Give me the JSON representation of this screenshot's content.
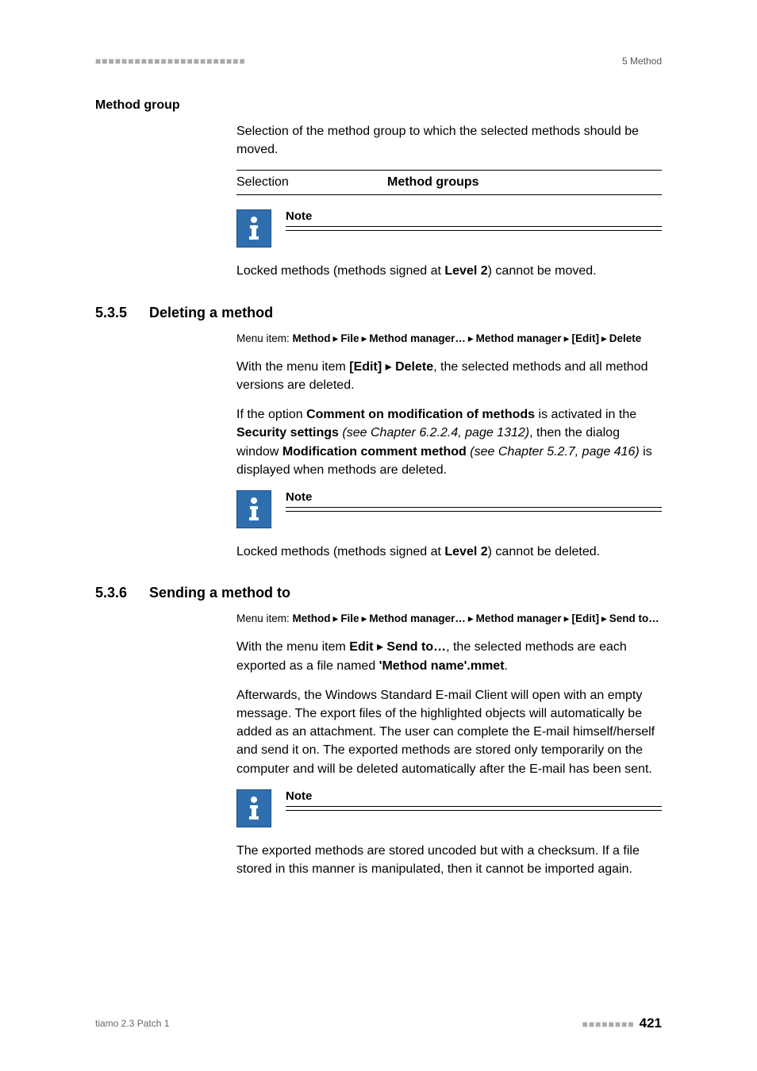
{
  "header": {
    "dashes": "■■■■■■■■■■■■■■■■■■■■■■■",
    "section_label": "5 Method"
  },
  "method_group": {
    "heading": "Method group",
    "body": "Selection of the method group to which the selected methods should be moved.",
    "selection_label": "Selection",
    "selection_value": "Method groups",
    "note_title": "Note",
    "note_body_pre": "Locked methods (methods signed at ",
    "note_body_bold": "Level 2",
    "note_body_post": ") cannot be moved."
  },
  "s535": {
    "num": "5.3.5",
    "title": "Deleting a method",
    "menu_prefix": "Menu item: ",
    "menu_parts": [
      "Method",
      "File",
      "Method manager…",
      "Method manager",
      "[Edit]",
      "Delete"
    ],
    "p1_pre": "With the menu item ",
    "p1_b1": "[Edit]",
    "p1_mid": " ▸ ",
    "p1_b2": "Delete",
    "p1_post": ", the selected methods and all method versions are deleted.",
    "p2_a": "If the option ",
    "p2_b1": "Comment on modification of methods",
    "p2_b": " is activated in the ",
    "p2_b2": "Security settings",
    "p2_i1": " (see Chapter 6.2.2.4, page 1312)",
    "p2_c": ", then the dialog window ",
    "p2_b3": "Modification comment method",
    "p2_i2": " (see Chapter 5.2.7, page 416)",
    "p2_d": " is displayed when methods are deleted.",
    "note_title": "Note",
    "note_body_pre": "Locked methods (methods signed at ",
    "note_body_bold": "Level 2",
    "note_body_post": ") cannot be deleted."
  },
  "s536": {
    "num": "5.3.6",
    "title": "Sending a method to",
    "menu_prefix": "Menu item: ",
    "menu_parts": [
      "Method",
      "File",
      "Method manager…",
      "Method manager",
      "[Edit]",
      "Send to…"
    ],
    "p1_pre": "With the menu item ",
    "p1_b1": "Edit",
    "p1_mid": " ▸ ",
    "p1_b2": "Send to…",
    "p1_post": ", the selected methods are each exported as a file named ",
    "p1_b3": "'Method name'.mmet",
    "p1_end": ".",
    "p2": "Afterwards, the Windows Standard E-mail Client will open with an empty message. The export files of the highlighted objects will automatically be added as an attachment. The user can complete the E-mail himself/herself and send it on. The exported methods are stored only temporarily on the computer and will be deleted automatically after the E-mail has been sent.",
    "note_title": "Note",
    "note_body": "The exported methods are stored uncoded but with a checksum. If a file stored in this manner is manipulated, then it cannot be imported again."
  },
  "footer": {
    "product": "tiamo 2.3 Patch 1",
    "squares": "■■■■■■■■",
    "page": "421"
  }
}
